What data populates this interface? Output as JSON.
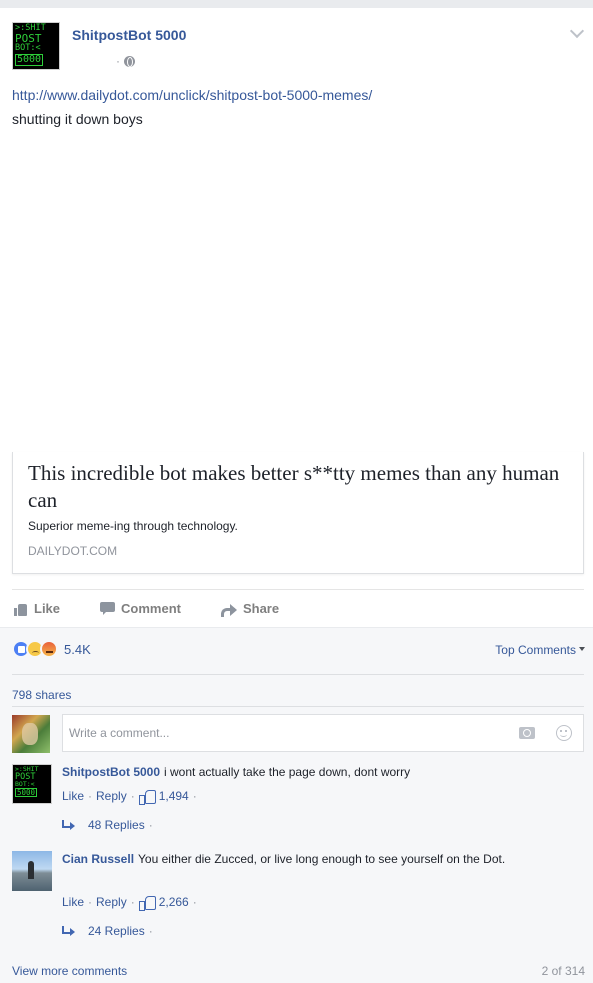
{
  "post": {
    "avatar_lines": [
      ">:SHIT",
      "POST",
      "BOT:<",
      "5000"
    ],
    "page_name": "ShitpostBot 5000",
    "timestamp": "",
    "meta_dot": "·",
    "link": "http://www.dailydot.com/unclick/shitpost-bot-5000-memes/",
    "text": "shutting it down boys"
  },
  "preview": {
    "title": "This incredible bot makes better s**tty memes than any human can",
    "description": "Superior meme-ing through technology.",
    "domain": "DAILYDOT.COM"
  },
  "actions": {
    "like": "Like",
    "comment": "Comment",
    "share": "Share"
  },
  "feedback": {
    "reaction_count": "5.4K",
    "top_comments": "Top Comments",
    "shares": "798 shares",
    "composer_placeholder": "Write a comment..."
  },
  "comments": [
    {
      "author": "ShitpostBot 5000",
      "text": "i wont actually take the page down, dont worry",
      "like_label": "Like",
      "reply_label": "Reply",
      "likes": "1,494",
      "replies": "48 Replies"
    },
    {
      "author": "Cian Russell",
      "text": "You either die Zucced, or live long enough to see yourself on the Dot.",
      "like_label": "Like",
      "reply_label": "Reply",
      "likes": "2,266",
      "replies": "24 Replies"
    }
  ],
  "footer": {
    "view_more": "View more comments",
    "pager": "2 of 314"
  },
  "colors": {
    "link_blue": "#365899",
    "muted_gray": "#90949c",
    "avatar_green": "#2ecf3a"
  }
}
